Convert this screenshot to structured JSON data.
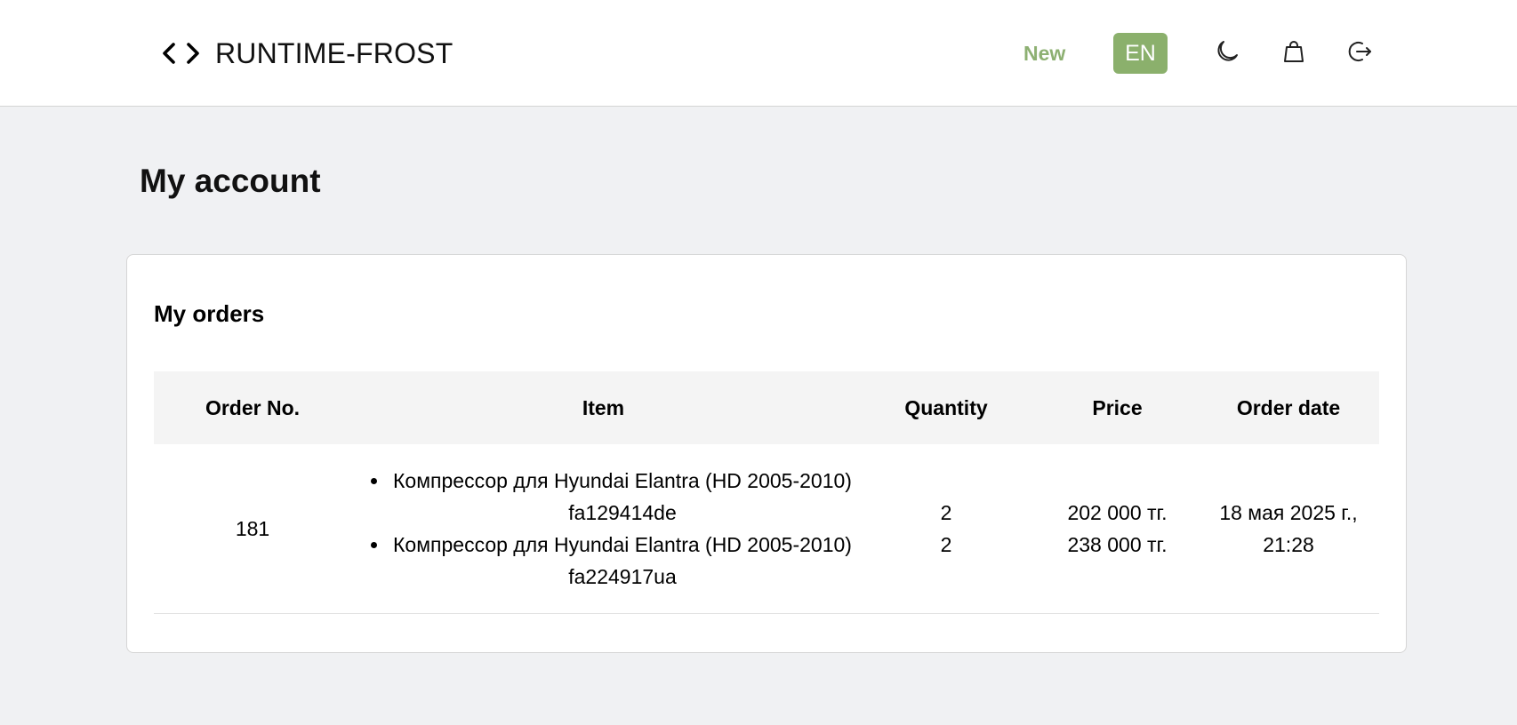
{
  "header": {
    "brand": "RUNTIME-FROST",
    "nav_new": "New",
    "language": "EN",
    "icons": [
      "code-icon",
      "moon-icon",
      "shopping-bag-icon",
      "logout-icon"
    ],
    "accent_color": "#8bb06c"
  },
  "page": {
    "title": "My account"
  },
  "orders": {
    "title": "My orders",
    "columns": [
      "Order No.",
      "Item",
      "Quantity",
      "Price",
      "Order date"
    ],
    "rows": [
      {
        "order_no": "181",
        "items": [
          "Компрессор для Hyundai Elantra (HD 2005-2010) fa129414de",
          "Компрессор для Hyundai Elantra (HD 2005-2010) fa224917ua"
        ],
        "quantities": [
          "2",
          "2"
        ],
        "prices": [
          "202 000 тг.",
          "238 000 тг."
        ],
        "order_date": "18 мая 2025 г., 21:28"
      }
    ]
  }
}
